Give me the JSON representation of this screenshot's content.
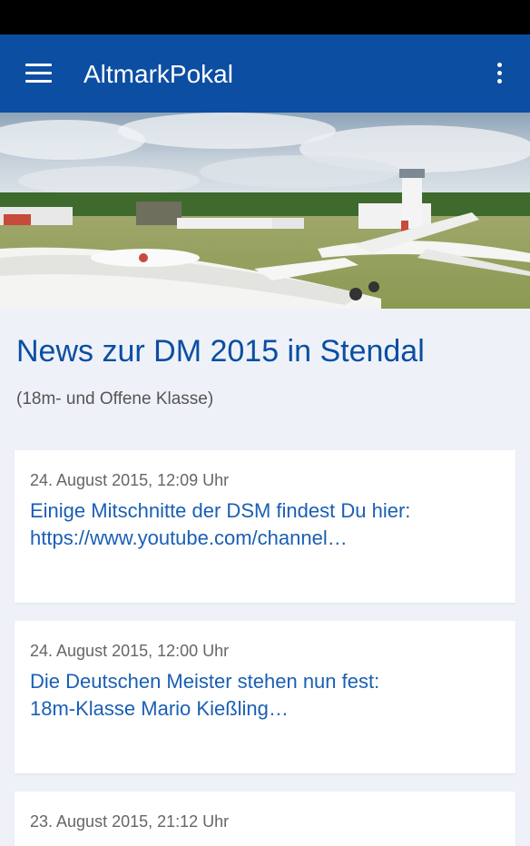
{
  "app_bar": {
    "title": "AltmarkPokal",
    "menu_icon": "hamburger-menu-icon",
    "overflow_icon": "more-vertical-icon",
    "color": "#0b4ea2"
  },
  "hero_image": {
    "description_icon": "glider-airfield-photo"
  },
  "page": {
    "headline": "News zur DM 2015 in Stendal",
    "subheadline": "(18m- und Offene Klasse)"
  },
  "news": [
    {
      "date": "24. August 2015, 12:09 Uhr",
      "line1": "Einige Mitschnitte der DSM findest Du hier:",
      "line2": "https://www.youtube.com/channel…"
    },
    {
      "date": "24. August 2015, 12:00 Uhr",
      "line1": "Die Deutschen Meister stehen nun fest:",
      "line2": "18m-Klasse Mario Kießling…"
    },
    {
      "date": "23. August 2015, 21:12 Uhr"
    }
  ],
  "colors": {
    "accent": "#0b4ea2",
    "link": "#1a5fb4",
    "background": "#eef2f8"
  }
}
